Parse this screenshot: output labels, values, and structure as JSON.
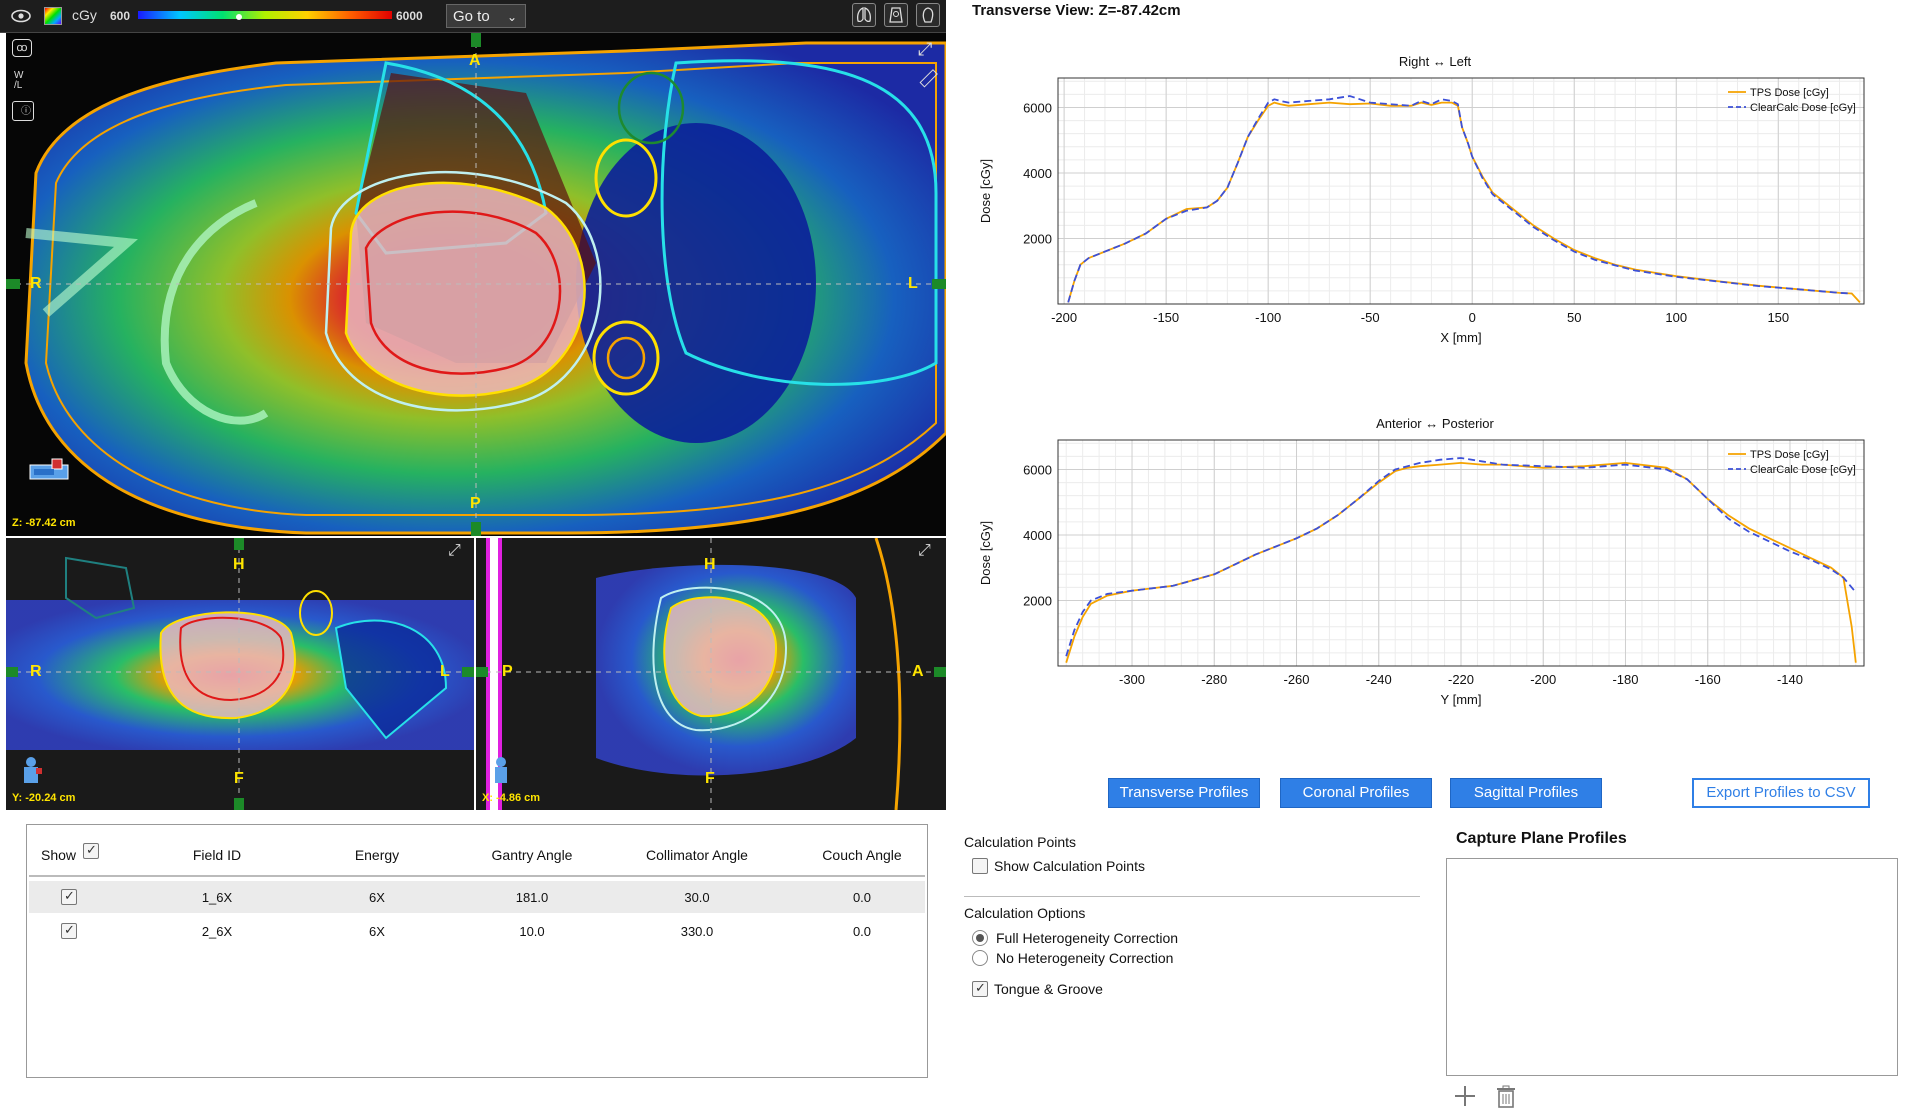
{
  "toolbar": {
    "unit_label": "cGy",
    "range_min": "600",
    "range_max": "6000",
    "goto_label": "Go to",
    "icons": [
      "eye-icon",
      "colorwash-icon",
      "lungs-view-icon",
      "torso-view-icon",
      "head-view-icon"
    ]
  },
  "viewports": {
    "transverse": {
      "slice_label": "Z: -87.42 cm",
      "top": "A",
      "bottom": "P",
      "left": "R",
      "right": "L"
    },
    "coronal": {
      "slice_label": "Y: -20.24 cm",
      "top": "H",
      "bottom": "F",
      "left": "R",
      "right": "L"
    },
    "sagittal": {
      "slice_label": "X: -4.86 cm",
      "top": "H",
      "bottom": "F",
      "left": "P",
      "right": "A"
    }
  },
  "view_title": "Transverse View:  Z=-87.42cm",
  "chart_data": [
    {
      "type": "line",
      "title": "Right ↔ Left",
      "xlabel": "X [mm]",
      "ylabel": "Dose [cGy]",
      "xlim": [
        -203,
        192
      ],
      "ylim": [
        0,
        6900
      ],
      "xticks": [
        -200,
        -150,
        -100,
        -50,
        0,
        50,
        100,
        150
      ],
      "yticks": [
        2000,
        4000,
        6000
      ],
      "legend": "top-right",
      "colors": {
        "tps": "#f5a300",
        "cc": "#3c50d8"
      },
      "series": [
        {
          "name": "TPS Dose [cGy]",
          "style": "solid",
          "x": [
            -198,
            -195,
            -192,
            -188,
            -180,
            -170,
            -160,
            -150,
            -140,
            -130,
            -125,
            -120,
            -115,
            -110,
            -105,
            -100,
            -97,
            -94,
            -90,
            -80,
            -70,
            -60,
            -50,
            -40,
            -30,
            -25,
            -20,
            -15,
            -10,
            -7,
            -5,
            -2,
            0,
            5,
            10,
            20,
            30,
            40,
            50,
            60,
            70,
            80,
            100,
            120,
            140,
            160,
            180,
            186,
            190
          ],
          "y": [
            50,
            700,
            1200,
            1400,
            1600,
            1850,
            2150,
            2600,
            2900,
            2950,
            3150,
            3550,
            4300,
            5100,
            5600,
            6050,
            6150,
            6100,
            6050,
            6100,
            6150,
            6100,
            6120,
            6050,
            6050,
            6150,
            6080,
            6150,
            6150,
            6050,
            5400,
            4900,
            4500,
            3900,
            3400,
            2900,
            2400,
            2000,
            1650,
            1400,
            1200,
            1050,
            850,
            700,
            560,
            450,
            340,
            320,
            50
          ]
        },
        {
          "name": "ClearCalc Dose [cGy]",
          "style": "dashed",
          "x": [
            -198,
            -195,
            -192,
            -188,
            -180,
            -170,
            -160,
            -150,
            -140,
            -130,
            -125,
            -120,
            -115,
            -110,
            -105,
            -100,
            -97,
            -94,
            -90,
            -80,
            -70,
            -60,
            -50,
            -40,
            -30,
            -25,
            -20,
            -15,
            -10,
            -7,
            -5,
            -2,
            0,
            5,
            10,
            20,
            30,
            40,
            50,
            60,
            70,
            80,
            100,
            120,
            140,
            160,
            180,
            186
          ],
          "y": [
            50,
            700,
            1200,
            1400,
            1600,
            1850,
            2150,
            2600,
            2850,
            2950,
            3150,
            3550,
            4300,
            5100,
            5650,
            6150,
            6250,
            6200,
            6150,
            6200,
            6250,
            6350,
            6150,
            6100,
            6050,
            6200,
            6100,
            6250,
            6200,
            6100,
            5400,
            4900,
            4500,
            3850,
            3350,
            2850,
            2350,
            1950,
            1600,
            1350,
            1180,
            1020,
            830,
            690,
            550,
            450,
            340,
            320
          ]
        }
      ]
    },
    {
      "type": "line",
      "title": "Anterior ↔ Posterior",
      "xlabel": "Y [mm]",
      "ylabel": "Dose [cGy]",
      "xlim": [
        -318,
        -122
      ],
      "ylim": [
        0,
        6900
      ],
      "xticks": [
        -300,
        -280,
        -260,
        -240,
        -220,
        -200,
        -180,
        -160,
        -140
      ],
      "yticks": [
        2000,
        4000,
        6000
      ],
      "legend": "top-right",
      "colors": {
        "tps": "#f5a300",
        "cc": "#3c50d8"
      },
      "series": [
        {
          "name": "TPS Dose [cGy]",
          "style": "solid",
          "x": [
            -316,
            -314,
            -312,
            -310,
            -306,
            -300,
            -290,
            -280,
            -270,
            -260,
            -255,
            -250,
            -245,
            -240,
            -236,
            -233,
            -230,
            -225,
            -220,
            -215,
            -210,
            -200,
            -190,
            -180,
            -170,
            -165,
            -160,
            -155,
            -150,
            -145,
            -140,
            -135,
            -130,
            -127,
            -125,
            -124
          ],
          "y": [
            100,
            900,
            1500,
            1900,
            2150,
            2300,
            2450,
            2800,
            3400,
            3900,
            4200,
            4600,
            5100,
            5600,
            5950,
            6050,
            6100,
            6150,
            6200,
            6150,
            6150,
            6050,
            6100,
            6200,
            6050,
            5700,
            5100,
            4600,
            4200,
            3900,
            3600,
            3300,
            3000,
            2700,
            1200,
            100
          ]
        },
        {
          "name": "ClearCalc Dose [cGy]",
          "style": "dashed",
          "x": [
            -316,
            -314,
            -312,
            -310,
            -306,
            -300,
            -290,
            -280,
            -270,
            -260,
            -255,
            -250,
            -245,
            -240,
            -236,
            -233,
            -230,
            -225,
            -220,
            -215,
            -210,
            -200,
            -190,
            -180,
            -170,
            -165,
            -160,
            -155,
            -150,
            -145,
            -140,
            -135,
            -130,
            -127,
            -124
          ],
          "y": [
            300,
            1100,
            1650,
            2000,
            2200,
            2300,
            2450,
            2800,
            3400,
            3900,
            4200,
            4600,
            5100,
            5650,
            6000,
            6100,
            6200,
            6300,
            6350,
            6250,
            6150,
            6100,
            6050,
            6150,
            6000,
            5700,
            5100,
            4500,
            4100,
            3800,
            3500,
            3250,
            2950,
            2700,
            2250
          ]
        }
      ]
    }
  ],
  "profile_buttons": {
    "transverse": "Transverse Profiles",
    "coronal": "Coronal Profiles",
    "sagittal": "Sagittal Profiles",
    "export": "Export Profiles to CSV"
  },
  "field_table": {
    "columns": [
      "Show",
      "Field ID",
      "Energy",
      "Gantry Angle",
      "Collimator Angle",
      "Couch Angle"
    ],
    "rows": [
      {
        "field_id": "1_6X",
        "energy": "6X",
        "gantry": "181.0",
        "collimator": "30.0",
        "couch": "0.0"
      },
      {
        "field_id": "2_6X",
        "energy": "6X",
        "gantry": "10.0",
        "collimator": "330.0",
        "couch": "0.0"
      }
    ]
  },
  "calc_points": {
    "title": "Calculation Points",
    "show_label": "Show Calculation Points"
  },
  "calc_options": {
    "title": "Calculation Options",
    "full_label": "Full Heterogeneity Correction",
    "no_label": "No Heterogeneity Correction",
    "tg_label": "Tongue & Groove"
  },
  "capture": {
    "title": "Capture Plane Profiles"
  }
}
